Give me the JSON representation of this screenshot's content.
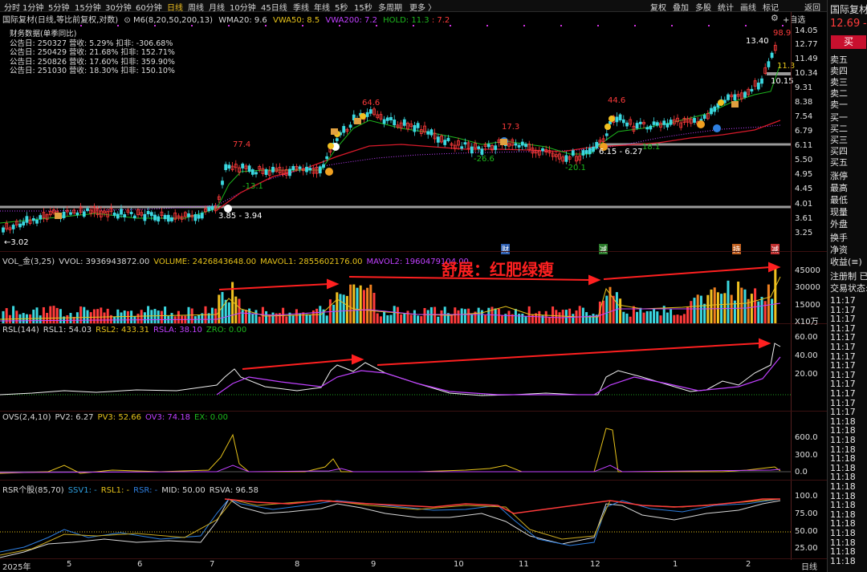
{
  "toolbar": {
    "periods": [
      "分时",
      "1分钟",
      "5分钟",
      "15分钟",
      "30分钟",
      "60分钟",
      "日线",
      "周线",
      "月线",
      "10分钟",
      "45日线",
      "季线",
      "年线",
      "5秒",
      "15秒",
      "多周期",
      "更多 〉"
    ],
    "active_period": "日线",
    "tools": [
      "复权",
      "叠加",
      "多股",
      "统计",
      "画线",
      "标记",
      "返回"
    ]
  },
  "main_header": {
    "title": "国际复材(日线,等比前复权,对数)",
    "m6": "M6(8,20,50,200,13)",
    "wma20": "WMA20: 9.6",
    "vwa50": "VWA50: 8.5",
    "vwa200": "VWA200: 7.2",
    "hold": "HOLD: 11.3",
    "hold2": "7.2",
    "settings_glyph": "⚙",
    "add_watch": "+自选"
  },
  "financial": {
    "title": "财务数据(单季同比)",
    "rows": [
      "公告日: 250327   营收:  5.29%   扣非:  -306.68%",
      "公告日: 250429   营收:  21.68%   扣非:  152.71%",
      "公告日: 250826   营收:  17.60%   扣非:  359.90%",
      "公告日: 251030   营收:  18.30%   扣非:  150.10%"
    ]
  },
  "price_axis": [
    "14.05",
    "12.77",
    "11.49",
    "10.34",
    "9.31",
    "8.38",
    "7.54",
    "6.79",
    "6.11",
    "5.50",
    "4.95",
    "4.45",
    "4.01",
    "3.61",
    "3.25"
  ],
  "price_annotations": {
    "left_low": "←3.02",
    "peak_1": "77.4",
    "drop_1": "-13.1",
    "peak_2": "64.6",
    "peak_3": "17.3",
    "drop_2": "-26.6",
    "drop_3": "-20.1",
    "peak_4": "44.6",
    "drop_4": "18.1",
    "peak_5": "98.9",
    "high_price": "13.40",
    "hold_label": "11.3",
    "last_low": "10.15",
    "range_1": "3.85 - 3.94",
    "range_2": "6.15 - 6.27"
  },
  "event_markers": {
    "cai": "财",
    "jian": "减",
    "chi": "持",
    "jiang": "减"
  },
  "volume": {
    "header": [
      "VOL_金(3,25)",
      "VVOL: 3936943872.00",
      "VOLUME: 2426843648.00",
      "MAVOL1: 2855602176.00",
      "MAVOL2: 1960479104.00"
    ],
    "annotation": "舒展：红肥绿瘦",
    "axis": [
      "45000",
      "30000",
      "15000"
    ],
    "unit": "X10万"
  },
  "rsl": {
    "header": [
      "RSL(144)",
      "RSL1: 54.03",
      "RSL2: 433.31",
      "RSLA: 38.10",
      "ZRO: 0.00"
    ],
    "axis": [
      "60.00",
      "40.00",
      "20.00"
    ]
  },
  "ovs": {
    "header": [
      "OVS(2,4,10)",
      "PV2: 6.27",
      "PV3: 52.66",
      "OV3: 74.18",
      "EX: 0.00"
    ],
    "axis": [
      "600.0",
      "300.0",
      "0.0"
    ]
  },
  "rsr": {
    "header": [
      "RSR个股(85,70)",
      "SSV1: -",
      "RSL1: -",
      "RSR: -",
      "MID: 50.00",
      "RSVA: 96.58"
    ],
    "axis": [
      "100.0",
      "75.00",
      "50.00",
      "25.00"
    ]
  },
  "xaxis": {
    "year": "2025年",
    "months": [
      "5",
      "6",
      "7",
      "8",
      "9",
      "10",
      "11",
      "12",
      "1",
      "2"
    ],
    "period_label": "日线"
  },
  "right_panel": {
    "name": "国际复材",
    "price": "12.69",
    "price_tail": "-0",
    "buy_button": "买",
    "rows": [
      "卖五",
      "卖四",
      "卖三",
      "卖二",
      "卖一",
      "买一",
      "买二",
      "买三",
      "买四",
      "买五",
      "涨停",
      "最高",
      "最低",
      "现量",
      "外盘",
      "换手",
      "净资",
      "收益(≡)",
      "注册制 已",
      "交易状态:"
    ],
    "times": [
      "11:17",
      "11:17",
      "11:17",
      "11:17",
      "11:17",
      "11:17",
      "11:17",
      "11:17",
      "11:17",
      "11:17",
      "11:17",
      "11:17",
      "11:17",
      "11:18",
      "11:18",
      "11:18",
      "11:18",
      "11:18",
      "11:18",
      "11:18",
      "11:18",
      "11:18",
      "11:18",
      "11:18",
      "11:18",
      "11:18",
      "11:18",
      "11:18",
      "11:18"
    ]
  },
  "colors": {
    "up": "#ff3b3b",
    "down": "#3bd8e0",
    "ma_green": "#1db81d",
    "ma_red": "#d81a2a",
    "vwa200": "#c040ff",
    "yellow": "#e6c21a",
    "accent": "#ff2020"
  }
}
